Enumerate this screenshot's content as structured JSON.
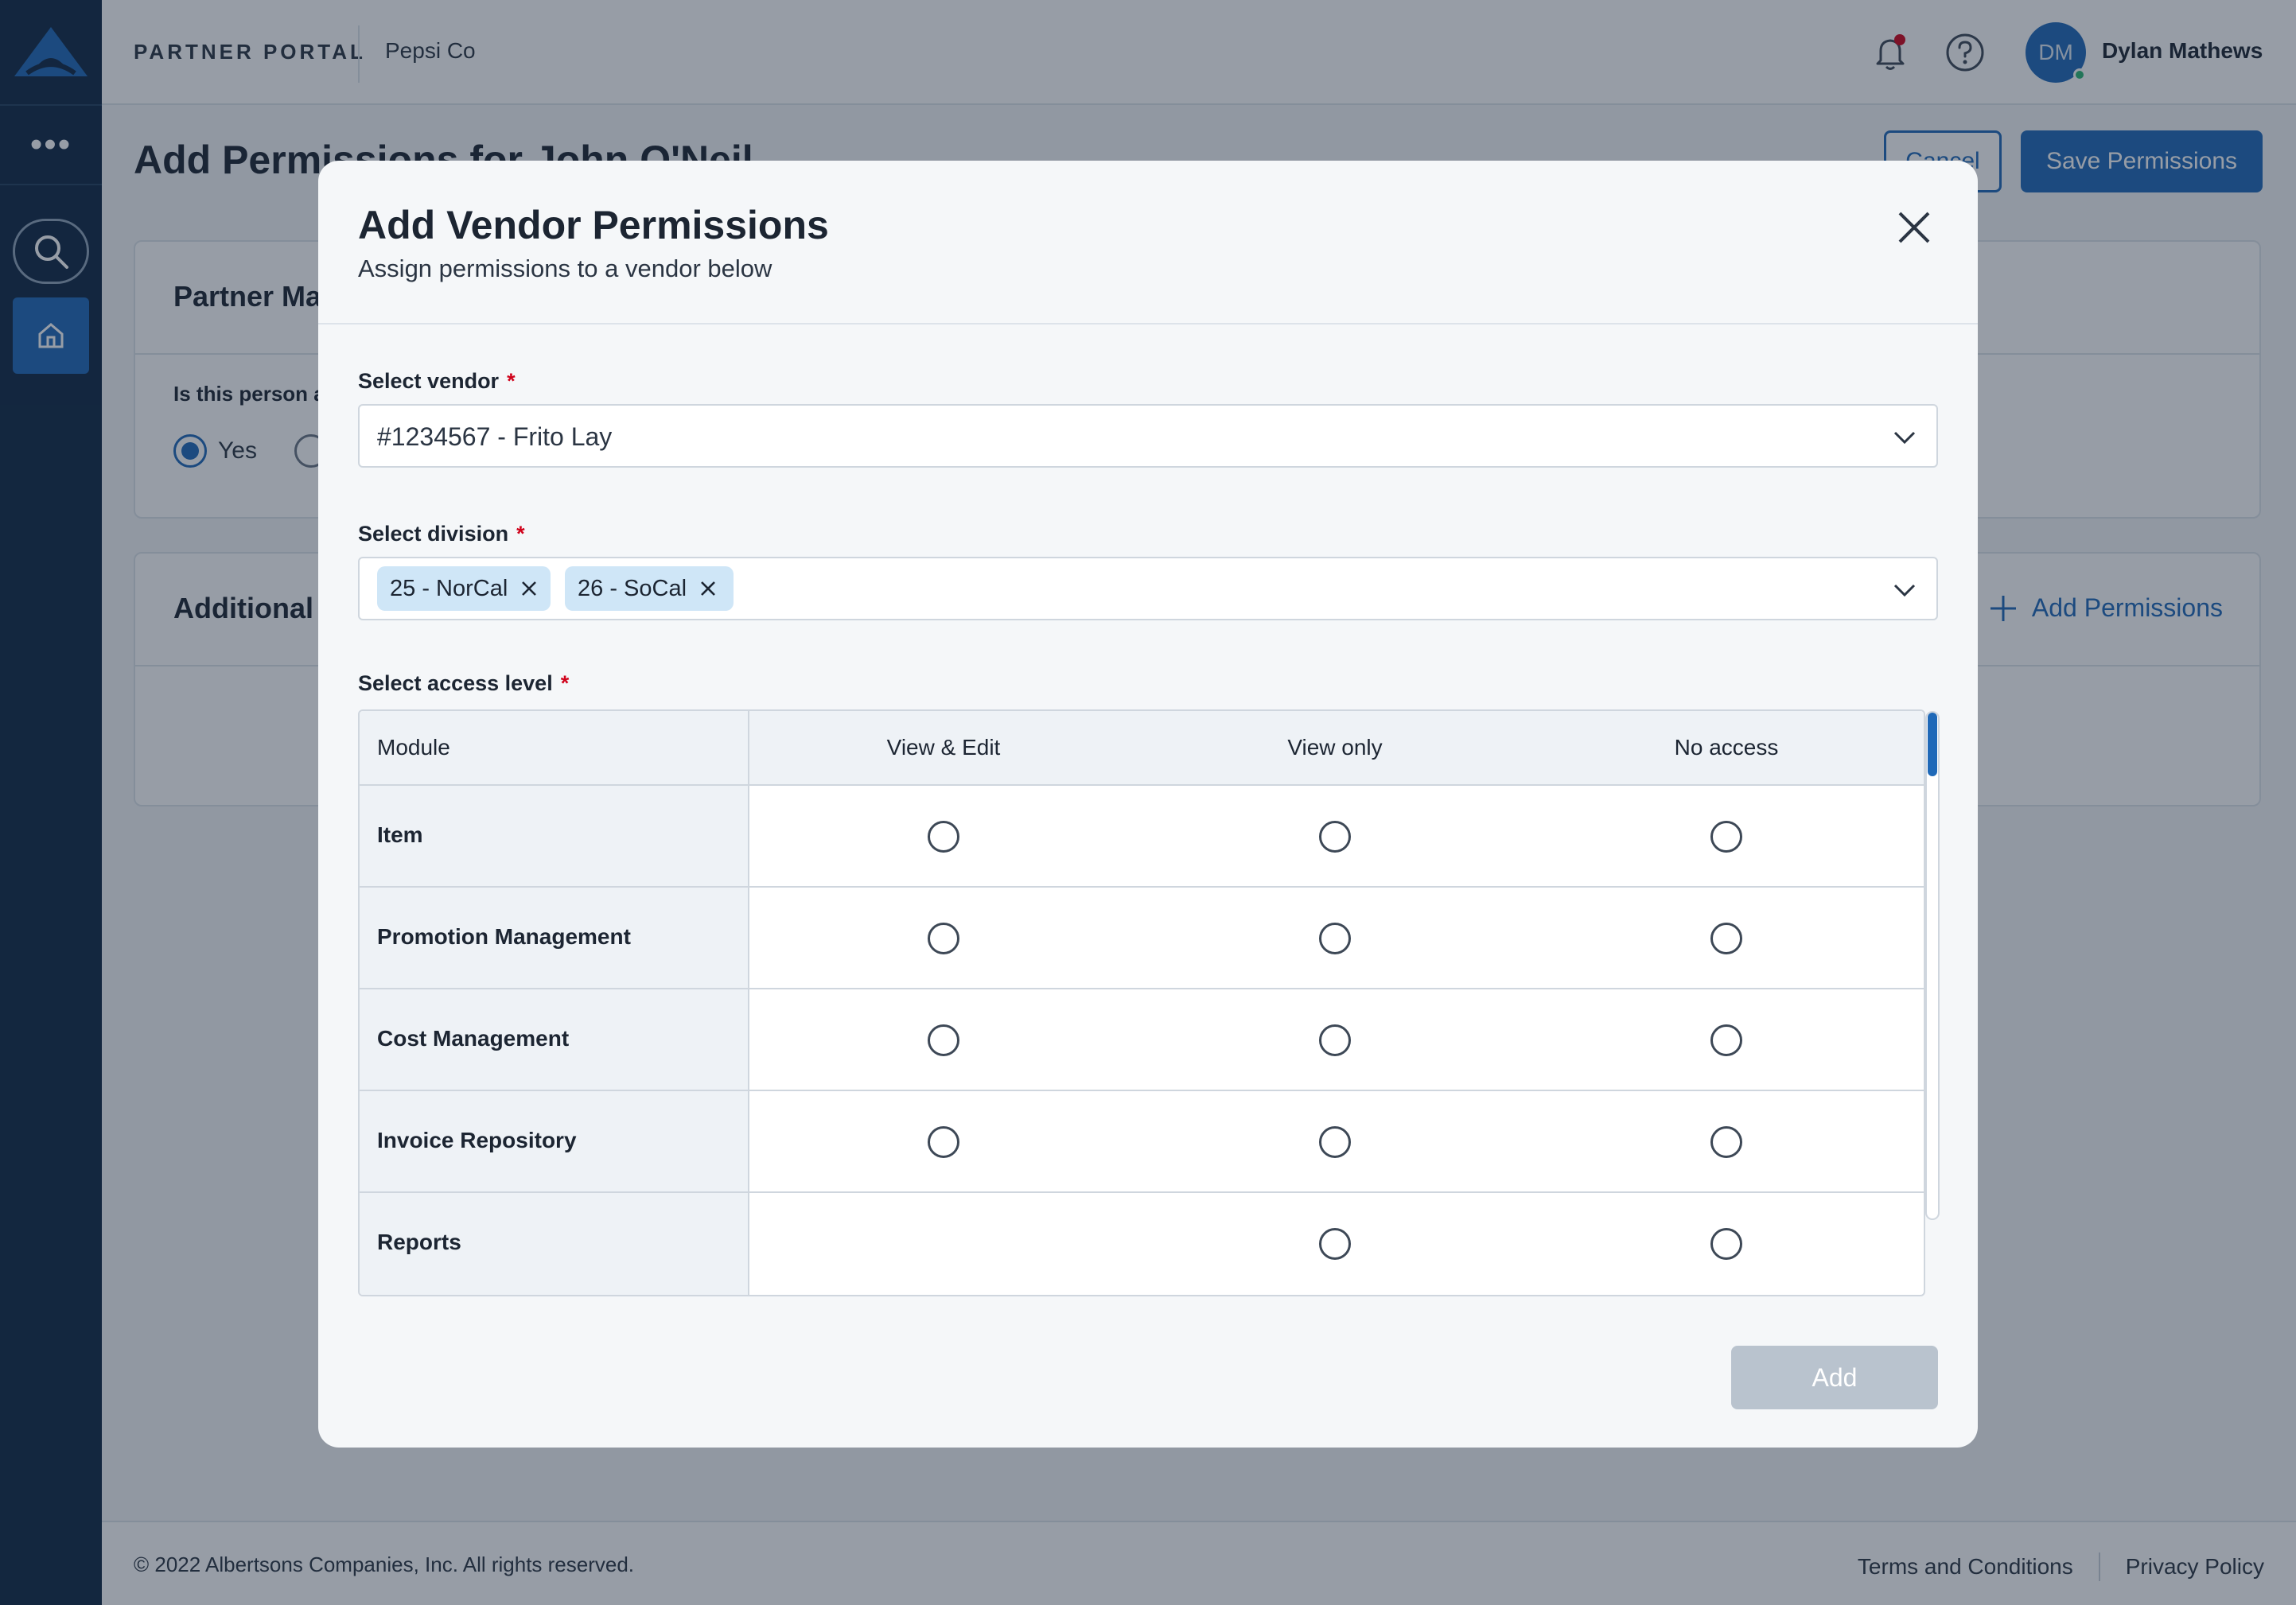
{
  "topbar": {
    "portal_title": "PARTNER PORTAL",
    "company": "Pepsi Co",
    "user_initials": "DM",
    "user_name": "Dylan Mathews"
  },
  "page": {
    "title": "Add Permissions for John O'Neil",
    "cancel_label": "Cancel",
    "save_label": "Save Permissions"
  },
  "card1": {
    "title": "Partner Ma",
    "question": "Is this person a",
    "yes_label": "Yes"
  },
  "card2": {
    "title": "Additional",
    "add_permissions_label": "Add Permissions"
  },
  "footer": {
    "copyright": "© 2022 Albertsons Companies, Inc. All rights reserved.",
    "terms": "Terms and Conditions",
    "privacy": "Privacy Policy"
  },
  "modal": {
    "title": "Add Vendor Permissions",
    "subtitle": "Assign permissions to a vendor below",
    "vendor": {
      "label": "Select vendor",
      "required_mark": "*",
      "value": "#1234567 - Frito Lay"
    },
    "division": {
      "label": "Select division",
      "required_mark": "*",
      "chips": [
        "25 - NorCal",
        "26 - SoCal"
      ]
    },
    "access": {
      "label": "Select access level",
      "required_mark": "*",
      "columns": [
        "Module",
        "View & Edit",
        "View only",
        "No access"
      ],
      "rows": [
        "Item",
        "Promotion Management",
        "Cost Management",
        "Invoice Repository",
        "Reports"
      ]
    },
    "add_label": "Add"
  },
  "colors": {
    "primary": "#1f69b8",
    "sidebar": "#0f2744",
    "required": "#d0021b",
    "chip_bg": "#cfe6f7",
    "disabled_button": "#b9c3ce"
  }
}
